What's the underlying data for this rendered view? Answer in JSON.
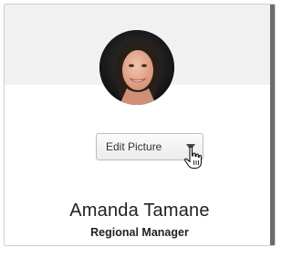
{
  "profile": {
    "name": "Amanda Tamane",
    "title": "Regional Manager"
  },
  "edit_picture": {
    "label": "Edit Picture",
    "caret_icon": "chevron-down-icon",
    "cursor_icon": "hand-pointer-icon"
  },
  "avatar": {
    "icon": "profile-photo"
  },
  "colors": {
    "header_bg": "#f1f1f1",
    "card_border": "#cfcfcf",
    "text": "#222222"
  }
}
